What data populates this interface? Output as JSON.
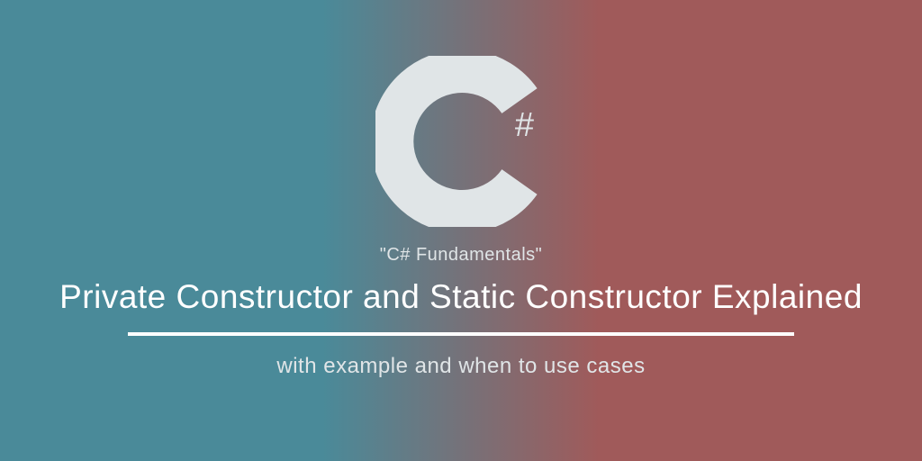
{
  "logo": {
    "letter": "C",
    "sharp": "#"
  },
  "tag": "\"C# Fundamentals\"",
  "title": "Private Constructor and Static Constructor Explained",
  "subtitle": "with example and when to use cases"
}
